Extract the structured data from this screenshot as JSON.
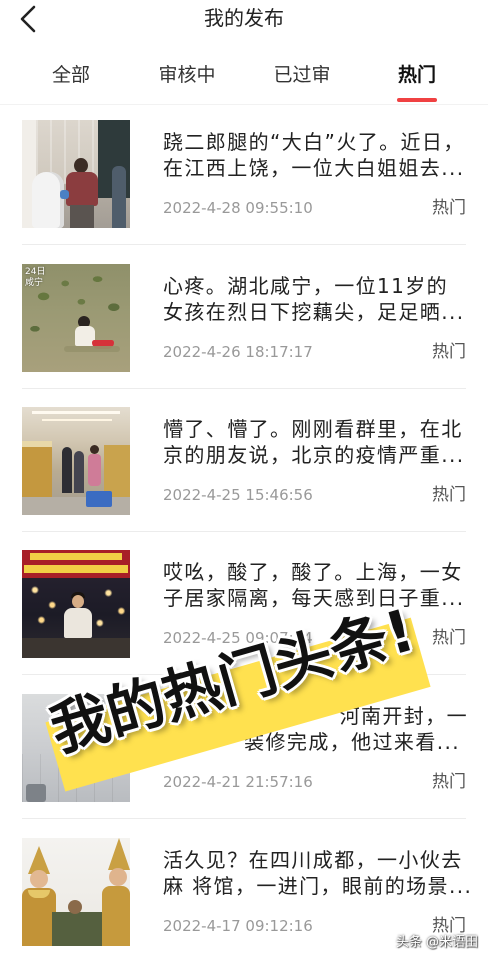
{
  "header": {
    "title": "我的发布",
    "back_icon": "chevron-left-icon"
  },
  "tabs": [
    {
      "label": "全部",
      "active": false
    },
    {
      "label": "审核中",
      "active": false
    },
    {
      "label": "已过审",
      "active": false
    },
    {
      "label": "热门",
      "active": true
    }
  ],
  "posts": [
    {
      "title_lines": [
        "跷二郎腿的“大白”火了。近日，",
        "在江西上饶，一位大白姐姐去..."
      ],
      "time": "2022-4-28 09:55:10",
      "tag": "热门"
    },
    {
      "title_lines": [
        "心疼。湖北咸宁，一位11岁的",
        "女孩在烈日下挖藕尖，足足晒..."
      ],
      "time": "2022-4-26 18:17:17",
      "tag": "热门",
      "thumb_caption": [
        "24日",
        "咸宁"
      ]
    },
    {
      "title_lines": [
        "懵了、懵了。刚刚看群里，在北",
        "京的朋友说，北京的疫情严重..."
      ],
      "time": "2022-4-25 15:46:56",
      "tag": "热门"
    },
    {
      "title_lines": [
        "哎吆，酸了，酸了。上海，一女",
        "子居家隔离，每天感到日子重..."
      ],
      "time": "2022-4-25 09:07:54",
      "tag": "热门"
    },
    {
      "title_lines": [
        "河南开封，一",
        "装修完成，他过来看..."
      ],
      "time": "2022-4-21 21:57:16",
      "tag": "热门"
    },
    {
      "title_lines": [
        "活久见？在四川成都，一小伙去",
        "麻 将馆，一进门，眼前的场景..."
      ],
      "time": "2022-4-17 09:12:16",
      "tag": "热门"
    }
  ],
  "banner": {
    "text": "我的热门头条!"
  },
  "watermark": "头条 @米语田",
  "colors": {
    "accent": "#f04142",
    "banner_yellow": "#ffe14f",
    "title_text": "#222222",
    "meta_text": "#999999",
    "tag_text": "#555555"
  }
}
